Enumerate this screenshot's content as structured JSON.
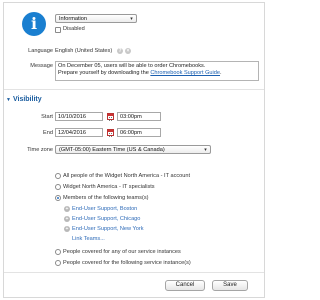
{
  "header": {
    "type_select": {
      "value": "Information"
    },
    "disabled": {
      "label": "Disabled",
      "checked": false
    },
    "language": {
      "label": "Language",
      "value": "English (United States)"
    },
    "message": {
      "label": "Message",
      "line1": "On December 05, users will be able to order Chromebooks.",
      "line2_prefix": "Prepare yourself by downloading the ",
      "line2_link": "Chromebook Support Guide",
      "line2_suffix": "."
    }
  },
  "visibility": {
    "title": "Visibility",
    "start": {
      "label": "Start",
      "date": "10/10/2016",
      "time": "03:00pm"
    },
    "end": {
      "label": "End",
      "date": "12/04/2016",
      "time": "06:00pm"
    },
    "timezone": {
      "label": "Time zone",
      "value": "(GMT-05:00) Eastern Time (US & Canada)"
    },
    "audience": [
      {
        "label": "All people of the Widget North America - IT account",
        "selected": false
      },
      {
        "label": "Widget North America - IT specialists",
        "selected": false
      },
      {
        "label": "Members of the following teams(s)",
        "selected": true
      },
      {
        "label": "People covered for any of our service instances",
        "selected": false
      },
      {
        "label": "People covered for the following service instance(s)",
        "selected": false
      }
    ],
    "teams": [
      "End-User Support, Boston",
      "End-User Support, Chicago",
      "End-User Support, New York"
    ],
    "link_teams": "Link Teams..."
  },
  "footer": {
    "cancel_label": "Cancel",
    "save_label": "Save"
  },
  "colors": {
    "accent": "#1a7fd0",
    "link": "#1a5fb0",
    "team": "#2e6bb8"
  }
}
